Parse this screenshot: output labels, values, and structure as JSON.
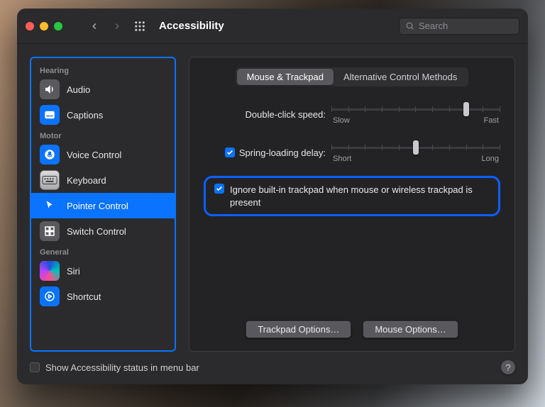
{
  "window": {
    "title": "Accessibility"
  },
  "search": {
    "placeholder": "Search"
  },
  "sidebar": {
    "sections": [
      {
        "label": "Hearing",
        "items": [
          {
            "name": "audio",
            "label": "Audio"
          },
          {
            "name": "captions",
            "label": "Captions"
          }
        ]
      },
      {
        "label": "Motor",
        "items": [
          {
            "name": "voice-control",
            "label": "Voice Control"
          },
          {
            "name": "keyboard",
            "label": "Keyboard"
          },
          {
            "name": "pointer-control",
            "label": "Pointer Control",
            "selected": true
          },
          {
            "name": "switch-control",
            "label": "Switch Control"
          }
        ]
      },
      {
        "label": "General",
        "items": [
          {
            "name": "siri",
            "label": "Siri"
          },
          {
            "name": "shortcut",
            "label": "Shortcut"
          }
        ]
      }
    ]
  },
  "tabs": {
    "items": [
      {
        "label": "Mouse & Trackpad",
        "selected": true
      },
      {
        "label": "Alternative Control Methods",
        "selected": false
      }
    ]
  },
  "controls": {
    "double_click": {
      "label": "Double-click speed:",
      "min_label": "Slow",
      "max_label": "Fast",
      "value_pct": 80
    },
    "spring_loading": {
      "enabled": true,
      "label": "Spring-loading delay:",
      "min_label": "Short",
      "max_label": "Long",
      "value_pct": 50
    },
    "ignore_trackpad": {
      "enabled": true,
      "label": "Ignore built-in trackpad when mouse or wireless trackpad is present"
    }
  },
  "buttons": {
    "trackpad_options": "Trackpad Options…",
    "mouse_options": "Mouse Options…"
  },
  "footer": {
    "show_status": {
      "enabled": false,
      "label": "Show Accessibility status in menu bar"
    }
  }
}
